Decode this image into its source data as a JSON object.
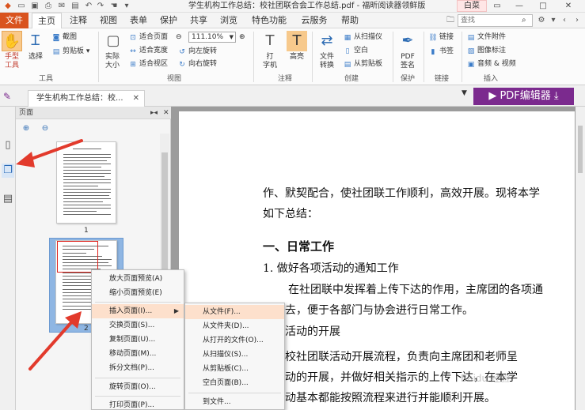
{
  "window": {
    "title": "学生机构工作总结：校社团联合会工作总结.pdf - 福昕阅读器领鲜版",
    "skin_label": "白菜"
  },
  "menu": {
    "file": "文件",
    "tabs": [
      "主页",
      "注释",
      "视图",
      "表单",
      "保护",
      "共享",
      "浏览",
      "特色功能",
      "云服务",
      "帮助"
    ],
    "active_tab": "主页",
    "search_placeholder": "查找"
  },
  "ribbon": {
    "tools": {
      "hand": "手型\n工具",
      "select": "选择",
      "screenshot": "截图",
      "clipboard": "剪贴板",
      "group": "工具"
    },
    "view": {
      "actual_size": "实际\n大小",
      "fit_page": "适合页面",
      "fit_width": "适合宽度",
      "fit_visible": "适合视区",
      "zoom": "111.10%",
      "rotate_left": "向左旋转",
      "rotate_right": "向右旋转",
      "group": "视图"
    },
    "annotate": {
      "typewriter": "打\n字机",
      "highlight": "高亮",
      "group": "注释"
    },
    "create": {
      "file_convert": "文件\n转换",
      "from_scanner": "从扫描仪",
      "blank": "空白",
      "from_clipboard": "从剪贴板",
      "group": "创建"
    },
    "protect": {
      "pdf_sign": "PDF\n签名",
      "group": "保护"
    },
    "links": {
      "link": "链接",
      "bookmark": "书签",
      "group": "链接"
    },
    "insert": {
      "attachment": "文件附件",
      "image_annot": "图像标注",
      "audio_video": "音频 & 视频",
      "group": "插入"
    }
  },
  "doc_tab": {
    "label": "学生机构工作总结：校...",
    "pdf_editor": "PDF编辑器"
  },
  "panel": {
    "title": "页面",
    "thumbnails": [
      {
        "page": "1"
      },
      {
        "page": "2"
      }
    ]
  },
  "context_menu": {
    "items": [
      "放大页面预览(A)",
      "缩小页面预览(E)",
      "插入页面(I)...",
      "交换页面(S)...",
      "复制页面(U)...",
      "移动页面(M)...",
      "拆分文档(P)...",
      "旋转页面(O)...",
      "打印页面(P)..."
    ],
    "highlighted": "插入页面(I)..."
  },
  "submenu": {
    "items": [
      "从文件(F)...",
      "从文件夹(D)...",
      "从打开的文件(O)...",
      "从扫描仪(S)...",
      "从剪贴板(C)...",
      "空白页面(B)...",
      "到文件..."
    ],
    "highlighted": "从文件(F)..."
  },
  "document": {
    "lines": [
      "作、默契配合，使社团联工作顺利，高效开展。现将本学",
      "如下总结：",
      "一、日常工作",
      "1. 做好各项活动的通知工作",
      "在社团联中发挥着上传下达的作用，主席团的各项通",
      "达下去，便于各部门与协会进行日常工作。",
      "协会活动的开展",
      "按照校社团联活动开展流程，负责向主席团和老师呈",
      "项活动的开展，并做好相关指示的上传下达，在本学",
      "的活动基本都能按照流程来进行并能顺利开展。"
    ]
  },
  "watermark": "Baidu 经验"
}
